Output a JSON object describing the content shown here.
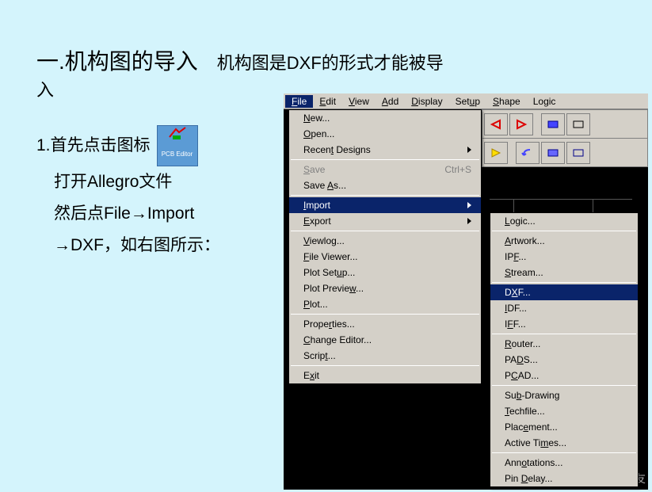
{
  "title": {
    "main": "一.机构图的导入",
    "sub1": "机构图是DXF的形式才能被导",
    "sub2": "入"
  },
  "instructions": {
    "num": "1.",
    "line1a": "首先点击图标",
    "icon_label": "PCB Editor",
    "line2": "打开Allegro文件",
    "line3": "然后点File→Import",
    "line4": "→DXF，如右图所示："
  },
  "menubar": {
    "items": [
      {
        "pre": "",
        "u": "F",
        "post": "ile",
        "active": true
      },
      {
        "pre": "",
        "u": "E",
        "post": "dit",
        "active": false
      },
      {
        "pre": "",
        "u": "V",
        "post": "iew",
        "active": false
      },
      {
        "pre": "",
        "u": "A",
        "post": "dd",
        "active": false
      },
      {
        "pre": "",
        "u": "D",
        "post": "isplay",
        "active": false
      },
      {
        "pre": "Set",
        "u": "u",
        "post": "p",
        "active": false
      },
      {
        "pre": "",
        "u": "S",
        "post": "hape",
        "active": false
      },
      {
        "pre": "Lo",
        "u": "g",
        "post": "ic",
        "active": false
      }
    ]
  },
  "file_menu": {
    "groups": [
      [
        {
          "label_pre": "",
          "label_u": "N",
          "label_post": "ew...",
          "disabled": false,
          "arrow": false,
          "shortcut": ""
        },
        {
          "label_pre": "",
          "label_u": "O",
          "label_post": "pen...",
          "disabled": false,
          "arrow": false,
          "shortcut": ""
        },
        {
          "label_pre": "Recen",
          "label_u": "t",
          "label_post": " Designs",
          "disabled": false,
          "arrow": true,
          "shortcut": ""
        }
      ],
      [
        {
          "label_pre": "",
          "label_u": "S",
          "label_post": "ave",
          "disabled": true,
          "arrow": false,
          "shortcut": "Ctrl+S"
        },
        {
          "label_pre": "Save ",
          "label_u": "A",
          "label_post": "s...",
          "disabled": false,
          "arrow": false,
          "shortcut": ""
        }
      ],
      [
        {
          "label_pre": "",
          "label_u": "I",
          "label_post": "mport",
          "disabled": false,
          "arrow": true,
          "shortcut": "",
          "highlight": true
        },
        {
          "label_pre": "",
          "label_u": "E",
          "label_post": "xport",
          "disabled": false,
          "arrow": true,
          "shortcut": ""
        }
      ],
      [
        {
          "label_pre": "",
          "label_u": "V",
          "label_post": "iewlog...",
          "disabled": false,
          "arrow": false,
          "shortcut": ""
        },
        {
          "label_pre": "",
          "label_u": "F",
          "label_post": "ile Viewer...",
          "disabled": false,
          "arrow": false,
          "shortcut": ""
        },
        {
          "label_pre": "Plot Set",
          "label_u": "u",
          "label_post": "p...",
          "disabled": false,
          "arrow": false,
          "shortcut": ""
        },
        {
          "label_pre": "Plot Previe",
          "label_u": "w",
          "label_post": "...",
          "disabled": false,
          "arrow": false,
          "shortcut": ""
        },
        {
          "label_pre": "",
          "label_u": "P",
          "label_post": "lot...",
          "disabled": false,
          "arrow": false,
          "shortcut": ""
        }
      ],
      [
        {
          "label_pre": "Prope",
          "label_u": "r",
          "label_post": "ties...",
          "disabled": false,
          "arrow": false,
          "shortcut": ""
        },
        {
          "label_pre": "",
          "label_u": "C",
          "label_post": "hange Editor...",
          "disabled": false,
          "arrow": false,
          "shortcut": ""
        },
        {
          "label_pre": "Scrip",
          "label_u": "t",
          "label_post": "...",
          "disabled": false,
          "arrow": false,
          "shortcut": ""
        }
      ],
      [
        {
          "label_pre": "E",
          "label_u": "x",
          "label_post": "it",
          "disabled": false,
          "arrow": false,
          "shortcut": ""
        }
      ]
    ]
  },
  "import_submenu": {
    "groups": [
      [
        {
          "label_pre": "",
          "label_u": "L",
          "label_post": "ogic..."
        }
      ],
      [
        {
          "label_pre": "",
          "label_u": "A",
          "label_post": "rtwork..."
        },
        {
          "label_pre": "IP",
          "label_u": "F",
          "label_post": "..."
        },
        {
          "label_pre": "",
          "label_u": "S",
          "label_post": "tream..."
        }
      ],
      [
        {
          "label_pre": "D",
          "label_u": "X",
          "label_post": "F...",
          "highlight": true
        },
        {
          "label_pre": "",
          "label_u": "I",
          "label_post": "DF..."
        },
        {
          "label_pre": "I",
          "label_u": "F",
          "label_post": "F..."
        }
      ],
      [
        {
          "label_pre": "",
          "label_u": "R",
          "label_post": "outer..."
        },
        {
          "label_pre": "PA",
          "label_u": "D",
          "label_post": "S..."
        },
        {
          "label_pre": "P",
          "label_u": "C",
          "label_post": "AD..."
        }
      ],
      [
        {
          "label_pre": "Su",
          "label_u": "b",
          "label_post": "-Drawing"
        },
        {
          "label_pre": "",
          "label_u": "T",
          "label_post": "echfile..."
        },
        {
          "label_pre": "Plac",
          "label_u": "e",
          "label_post": "ment..."
        },
        {
          "label_pre": "Active Ti",
          "label_u": "m",
          "label_post": "es..."
        }
      ],
      [
        {
          "label_pre": "Ann",
          "label_u": "o",
          "label_post": "tations..."
        },
        {
          "label_pre": "Pin ",
          "label_u": "D",
          "label_post": "elay..."
        }
      ]
    ]
  },
  "watermark": {
    "icon": "e",
    "text": "电子发烧友"
  }
}
